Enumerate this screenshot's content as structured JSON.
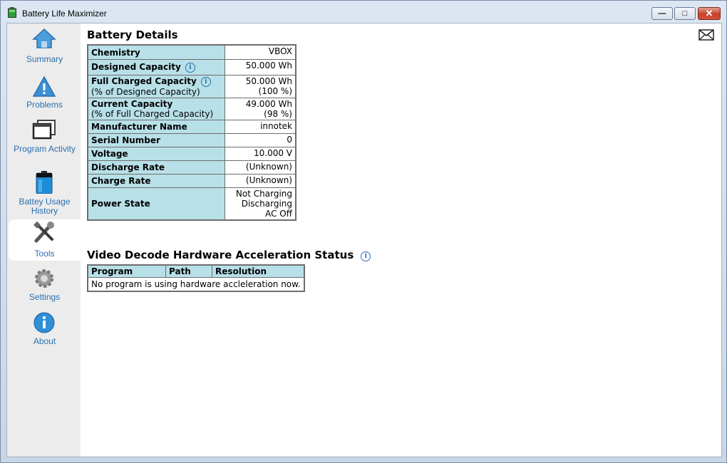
{
  "window": {
    "title": "Battery Life Maximizer",
    "controls": {
      "minimize": "—",
      "maximize": "□",
      "close": "✕"
    }
  },
  "sidebar": {
    "items": [
      {
        "label": "Summary",
        "icon": "home-icon"
      },
      {
        "label": "Problems",
        "icon": "warning-icon"
      },
      {
        "label": "Program Activity",
        "icon": "windows-icon"
      },
      {
        "label": "Battey Usage History",
        "icon": "battery-icon"
      },
      {
        "label": "Tools",
        "icon": "tools-icon",
        "active": true
      },
      {
        "label": "Settings",
        "icon": "gear-icon"
      },
      {
        "label": "About",
        "icon": "info-icon"
      }
    ]
  },
  "battery_details": {
    "title": "Battery Details",
    "rows": [
      {
        "label": "Chemistry",
        "value": "VBOX"
      },
      {
        "label": "Designed Capacity",
        "value": "50.000 Wh",
        "info": true
      },
      {
        "label": "Full Charged Capacity",
        "sublabel": "(% of Designed Capacity)",
        "value": "50.000 Wh",
        "value2": "(100 %)",
        "info": true
      },
      {
        "label": "Current Capacity",
        "sublabel": "(% of Full Charged Capacity)",
        "value": "49.000 Wh",
        "value2": "(98 %)"
      },
      {
        "label": "Manufacturer Name",
        "value": "innotek"
      },
      {
        "label": "Serial Number",
        "value": "0"
      },
      {
        "label": "Voltage",
        "value": "10.000 V"
      },
      {
        "label": "Discharge Rate",
        "value": "(Unknown)"
      },
      {
        "label": "Charge Rate",
        "value": "(Unknown)"
      },
      {
        "label": "Power State",
        "value": "Not Charging",
        "value2": "Discharging",
        "value3": "AC Off"
      }
    ]
  },
  "video_decode": {
    "title": "Video Decode Hardware Acceleration Status",
    "columns": [
      "Program",
      "Path",
      "Resolution"
    ],
    "message": "No program is using hardware accleleration now."
  },
  "info_glyph": "i",
  "colors": {
    "accent": "#2a6fb0",
    "table_header": "#b8e0e8",
    "sidebar_bg": "#ececec"
  }
}
